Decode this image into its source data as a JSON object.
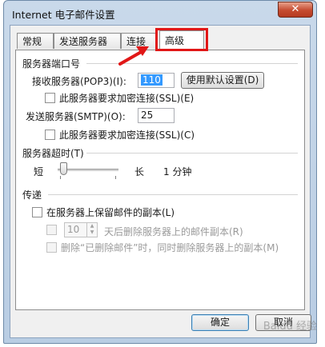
{
  "window": {
    "title": "Internet 电子邮件设置",
    "close_glyph": "✕"
  },
  "tabs": [
    {
      "label": "常规"
    },
    {
      "label": "发送服务器"
    },
    {
      "label": "连接"
    },
    {
      "label": "高级",
      "active": true
    }
  ],
  "ports": {
    "group_label": "服务器端口号",
    "incoming_label": "接收服务器(POP3)(I):",
    "incoming_value": "110",
    "use_defaults_button": "使用默认设置(D)",
    "incoming_ssl_label": "此服务器要求加密连接(SSL)(E)",
    "incoming_ssl_checked": false,
    "outgoing_label": "发送服务器(SMTP)(O):",
    "outgoing_value": "25",
    "outgoing_ssl_label": "此服务器要求加密连接(SSL)(C)",
    "outgoing_ssl_checked": false
  },
  "timeout": {
    "label": "服务器超时(T)",
    "short_label": "短",
    "long_label": "长",
    "value_text": "1 分钟",
    "level_fraction": 0.05
  },
  "delivery": {
    "group_label": "传递",
    "leave_copy_label": "在服务器上保留邮件的副本(L)",
    "leave_copy_checked": false,
    "remove_after_days_value": "10",
    "remove_after_label": "天后删除服务器上的邮件副本(R)",
    "remove_when_deleted_label": "删除“已删除邮件”时，同时删除服务器上的副本(M)"
  },
  "buttons": {
    "ok": "确定",
    "cancel": "取消"
  },
  "watermark": "Baidu 经验",
  "annotation": {
    "color": "#e11717"
  }
}
